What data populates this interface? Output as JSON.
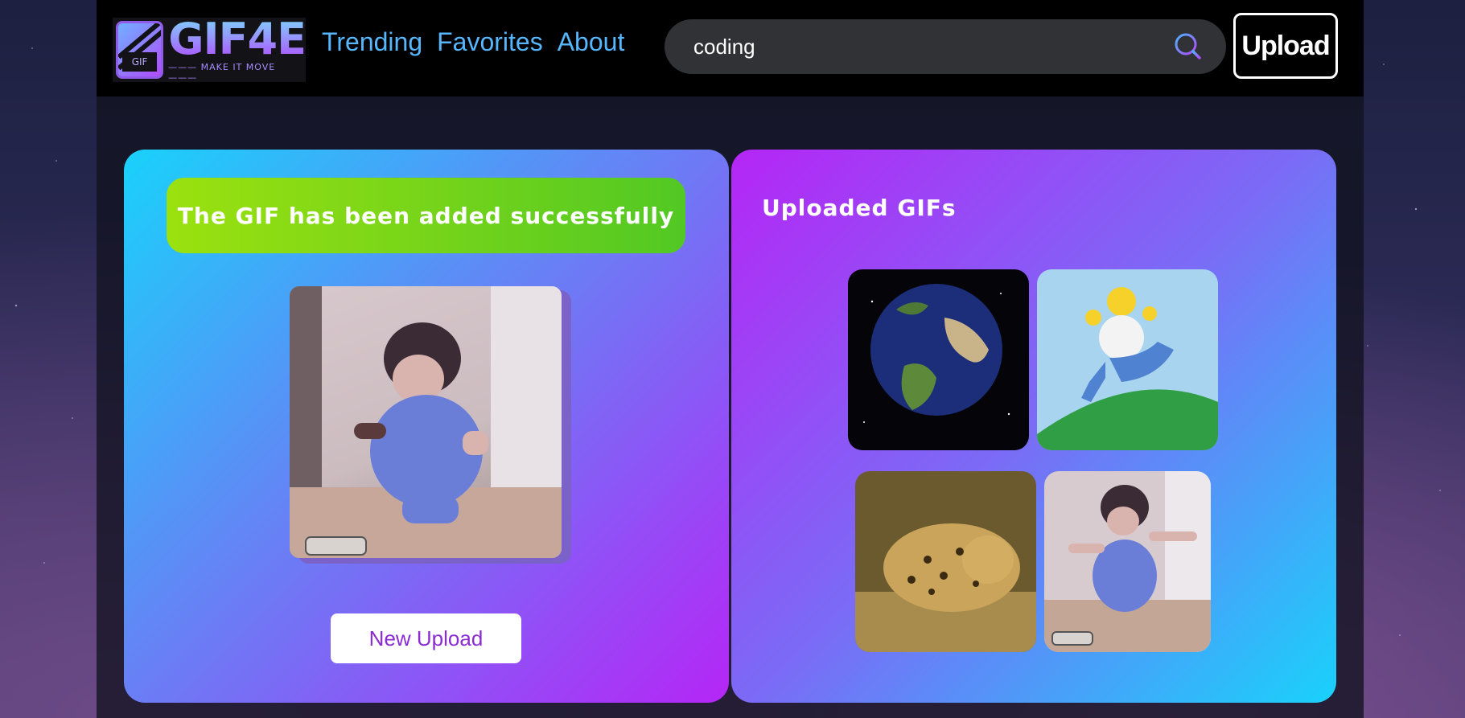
{
  "navbar": {
    "logo": {
      "word": "GIF4E",
      "tagline": "MAKE IT MOVE",
      "badge": "GIF"
    },
    "links": [
      {
        "label": "Trending"
      },
      {
        "label": "Favorites"
      },
      {
        "label": "About"
      }
    ],
    "search": {
      "value": "coding",
      "icon": "search-icon"
    },
    "upload_label": "Upload"
  },
  "upload_panel": {
    "success_message": "The GIF has been added successfully",
    "preview_gif": "dancing-kid",
    "new_upload_label": "New Upload"
  },
  "uploaded_panel": {
    "title": "Uploaded GIFs",
    "gifs": [
      {
        "subject": "spinning-earth"
      },
      {
        "subject": "homer-running"
      },
      {
        "subject": "leopard-walking"
      },
      {
        "subject": "dancing-kid"
      }
    ]
  },
  "colors": {
    "nav_link": "#56b7ff",
    "success_start": "#9be10f",
    "success_end": "#52c824",
    "new_upload_text": "#8a2ad0"
  }
}
